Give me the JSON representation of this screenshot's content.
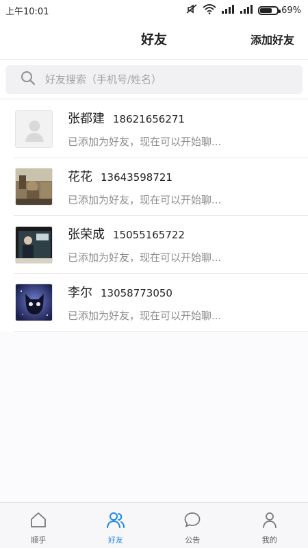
{
  "status_bar": {
    "time": "上午10:01",
    "battery": "69%",
    "battery_level": 0.69
  },
  "nav": {
    "title": "好友",
    "action": "添加好友"
  },
  "search": {
    "placeholder": "好友搜索（手机号/姓名）",
    "value": ""
  },
  "friends": [
    {
      "name": "张都建",
      "phone": "18621656271",
      "status": "已添加为好友，现在可以开始聊...",
      "avatar": "default-avatar"
    },
    {
      "name": "花花",
      "phone": "13643598721",
      "status": "已添加为好友，现在可以开始聊...",
      "avatar": "photo-avatar"
    },
    {
      "name": "张荣成",
      "phone": "15055165722",
      "status": "已添加为好友，现在可以开始聊...",
      "avatar": "photo-avatar"
    },
    {
      "name": "李尔",
      "phone": "13058773050",
      "status": "已添加为好友，现在可以开始聊...",
      "avatar": "photo-avatar"
    }
  ],
  "tabs": [
    {
      "label": "顺乎",
      "icon": "home-icon",
      "active": false
    },
    {
      "label": "好友",
      "icon": "friends-icon",
      "active": true
    },
    {
      "label": "公告",
      "icon": "chat-bubble-icon",
      "active": false
    },
    {
      "label": "我的",
      "icon": "profile-icon",
      "active": false
    }
  ],
  "colors": {
    "accent": "#1e88e5",
    "tab_inactive": "#555555",
    "text_secondary": "#8c8c8c"
  }
}
